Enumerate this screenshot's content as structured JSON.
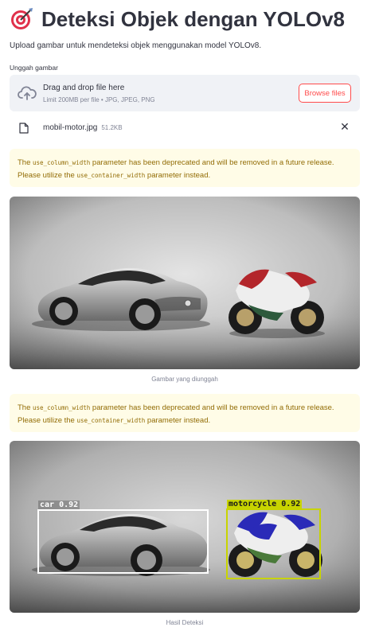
{
  "header": {
    "icon": "target-icon",
    "title": "Deteksi Objek dengan YOLOv8",
    "subtitle": "Upload gambar untuk mendeteksi objek menggunakan model YOLOv8."
  },
  "uploader": {
    "label": "Unggah gambar",
    "drop_text": "Drag and drop file here",
    "hint": "Limit 200MB per file • JPG, JPEG, PNG",
    "browse_label": "Browse files",
    "accent_color": "#ff4b4b"
  },
  "file": {
    "name": "mobil-motor.jpg",
    "size": "51.2KB",
    "remove_icon": "close-icon"
  },
  "warning": {
    "text_before": "The ",
    "param_old": "use_column_width",
    "text_middle": " parameter has been deprecated and will be removed in a future release. Please utilize the ",
    "param_new": "use_container_width",
    "text_after": " parameter instead."
  },
  "images": {
    "uploaded_caption": "Gambar yang diunggah",
    "result_caption": "Hasil Deteksi"
  },
  "detections": [
    {
      "label": "car 0.92",
      "color": "#ffffff"
    },
    {
      "label": "motorcycle 0.92",
      "color": "#c8d400"
    }
  ]
}
